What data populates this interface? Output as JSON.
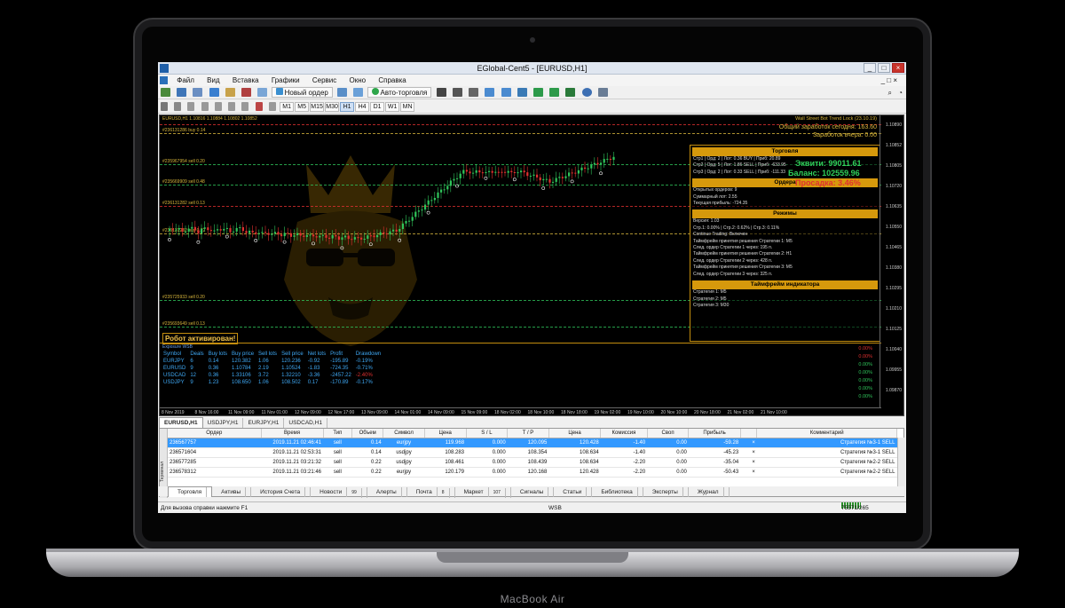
{
  "device": {
    "label": "MacBook Air"
  },
  "window": {
    "title": "EGlobal-Cent5 - [EURUSD,H1]"
  },
  "menu": [
    "Файл",
    "Вид",
    "Вставка",
    "Графики",
    "Сервис",
    "Окно",
    "Справка"
  ],
  "toolbar": {
    "new_order": "Новый ордер",
    "autotrading": "Авто-торговля"
  },
  "timeframes": [
    "M1",
    "M5",
    "M15",
    "M30",
    "H1",
    "H4",
    "D1",
    "W1",
    "MN"
  ],
  "active_timeframe": "H1",
  "chart": {
    "header": "EURUSD,H1  1.10816 1.10884 1.10802 1.10852",
    "ea_name": "Wall Street Bot Trend Lock (23.10.19)",
    "earned_today": "Общий заработок сегодня: 163.60",
    "earned_yesterday": "Заработок вчера: 0.00",
    "price_ticks": [
      "1.10890",
      "1.10852",
      "1.10805",
      "1.10720",
      "1.10635",
      "1.10550",
      "1.10465",
      "1.10380",
      "1.10295",
      "1.10210",
      "1.10125",
      "1.10040",
      "1.09955",
      "1.09870"
    ],
    "time_ticks": [
      "8 Nov 2019",
      "8 Nov 16:00",
      "11 Nov 09:00",
      "11 Nov 01:00",
      "12 Nov 09:00",
      "12 Nov 17:00",
      "13 Nov 09:00",
      "14 Nov 01:00",
      "14 Nov 09:00",
      "15 Nov 09:00",
      "18 Nov 02:00",
      "18 Nov 10:00",
      "18 Nov 18:00",
      "19 Nov 02:00",
      "19 Nov 10:00",
      "20 Nov 10:00",
      "20 Nov 18:00",
      "21 Nov 02:00",
      "21 Nov 10:00"
    ],
    "order_lines": [
      {
        "label": "#236131286 buy 0.14",
        "color": "#d8b63c"
      },
      {
        "label": "#235967954 sell 0.20",
        "color": "#2fc45a"
      },
      {
        "label": "#235669909 sell 0.48",
        "color": "#2fc45a"
      },
      {
        "label": "#236131282 sell 0.13",
        "color": "#e03030"
      },
      {
        "label": "#236131282 buy 0.22",
        "color": "#d8b63c"
      },
      {
        "label": "#235725933 sell 0.20",
        "color": "#2fc45a"
      },
      {
        "label": "#235693649 sell 0.13",
        "color": "#2fc45a"
      }
    ],
    "robot_status": "Робот активирован!"
  },
  "panel": {
    "trading_head": "Торговля",
    "trading_rows": [
      "Стр1 | Орд: 2 | Лот: 0.36 BUY | Приб: 20.89",
      "Стр2 | Орд: 5 | Лот: 1.86 SELL | Приб: -633.95",
      "Стр3 | Орд: 2 | Лот: 0.33 SELL | Приб: -111.33"
    ],
    "equity": "Эквити: 99011.61",
    "balance": "Баланс: 102559.96",
    "drawdown": "Просадка: 3.46%",
    "orders_head": "Ордера",
    "orders_rows": [
      "Открытых ордеров: 9",
      "Суммарный лот: 2.55",
      "Текущая прибыль: -724.35"
    ],
    "modes_head": "Режимы",
    "modes_rows": [
      "Версия: 1.03",
      "Стр.1:   0.00%  | Стр.2:   0.62%  | Стр.3:   0.11%",
      "Continue Trading: Включен",
      "Таймфрейм принятия решения Стратегии 1: M5",
      "След. ордер Стратегии 1 через: 195 п.",
      "Таймфрейм принятия решения Стратегии 2: H1",
      "След. ордер Стратегии 2 через: 428 п.",
      "Таймфрейм принятия решения Стратегии 3: M5",
      "След. ордер Стратегии 3 через: 325 п."
    ],
    "tf_head": "Таймфрейм индикатора",
    "tf_rows": [
      "Стратегия 1: M5",
      "Стратегия 2: M5",
      "Стратегия 3: M30"
    ]
  },
  "wsb": {
    "title": "Exposure WSB",
    "headers": [
      "Symbol",
      "Deals",
      "Buy lots",
      "Buy price",
      "Sell lots",
      "Sell price",
      "Net lots",
      "Profit",
      "Drawdown"
    ],
    "rows": [
      [
        "EURJPY",
        "6",
        "0.14",
        "120.382",
        "1.06",
        "120.236",
        "-0.92",
        "-195.89",
        "-0.19%"
      ],
      [
        "EURUSD",
        "9",
        "0.36",
        "1.10784",
        "2.19",
        "1.10524",
        "-1.83",
        "-724.35",
        "-0.71%"
      ],
      [
        "USDCAD",
        "12",
        "0.36",
        "1.33106",
        "3.72",
        "1.32210",
        "-3.36",
        "-2457.22",
        "-2.40%"
      ],
      [
        "USDJPY",
        "9",
        "1.23",
        "108.650",
        "1.06",
        "108.502",
        "0.17",
        "-170.89",
        "-0.17%"
      ]
    ],
    "right_col": [
      "0.00%",
      "0.00%",
      "0.00%",
      "0.00%",
      "0.00%",
      "0.00%",
      "0.00%"
    ]
  },
  "chart_tabs": [
    "EURUSD,H1",
    "USDJPY,H1",
    "EURJPY,H1",
    "USDCAD,H1"
  ],
  "orders": {
    "headers": [
      "Ордер",
      "Время",
      "Тип",
      "Объем",
      "Символ",
      "Цена",
      "S / L",
      "T / P",
      "Цена",
      "Комиссия",
      "Своп",
      "Прибыль",
      "",
      "Комментарий"
    ],
    "rows": [
      [
        "236567757",
        "2019.11.21 02:46:41",
        "sell",
        "0.14",
        "eurjpy",
        "119.968",
        "0.000",
        "120.095",
        "120.428",
        "-1.40",
        "0.00",
        "-59.28",
        "×",
        "Стратегия №3-1 SELL"
      ],
      [
        "236571604",
        "2019.11.21 02:53:31",
        "sell",
        "0.14",
        "usdjpy",
        "108.283",
        "0.000",
        "108.354",
        "108.634",
        "-1.40",
        "0.00",
        "-45.23",
        "×",
        "Стратегия №3-1 SELL"
      ],
      [
        "236577285",
        "2019.11.21 03:21:32",
        "sell",
        "0.22",
        "usdjpy",
        "108.461",
        "0.000",
        "108.439",
        "108.634",
        "-2.20",
        "0.00",
        "-35.04",
        "×",
        "Стратегия №2-2 SELL"
      ],
      [
        "236578312",
        "2019.11.21 03:21:46",
        "sell",
        "0.22",
        "eurjpy",
        "120.179",
        "0.000",
        "120.168",
        "120.428",
        "-2.20",
        "0.00",
        "-50.43",
        "×",
        "Стратегия №2-2 SELL"
      ]
    ]
  },
  "terminal_side": "Терминал",
  "terminal_tabs": [
    {
      "label": "Торговля",
      "badge": ""
    },
    {
      "label": "Активы",
      "badge": ""
    },
    {
      "label": "История Счета",
      "badge": ""
    },
    {
      "label": "Новости",
      "badge": "99"
    },
    {
      "label": "Алерты",
      "badge": ""
    },
    {
      "label": "Почта",
      "badge": "8"
    },
    {
      "label": "Маркет",
      "badge": "107"
    },
    {
      "label": "Сигналы",
      "badge": ""
    },
    {
      "label": "Статьи",
      "badge": ""
    },
    {
      "label": "Библиотека",
      "badge": ""
    },
    {
      "label": "Эксперты",
      "badge": ""
    },
    {
      "label": "Журнал",
      "badge": ""
    }
  ],
  "status": {
    "help": "Для вызова справки нажмите F1",
    "profile": "WSB",
    "memory": "75571/265 kb"
  },
  "colors": {
    "accent_gold": "#d6990c",
    "bull": "#2fc45a",
    "bear": "#e03030",
    "selection": "#3399ff"
  }
}
